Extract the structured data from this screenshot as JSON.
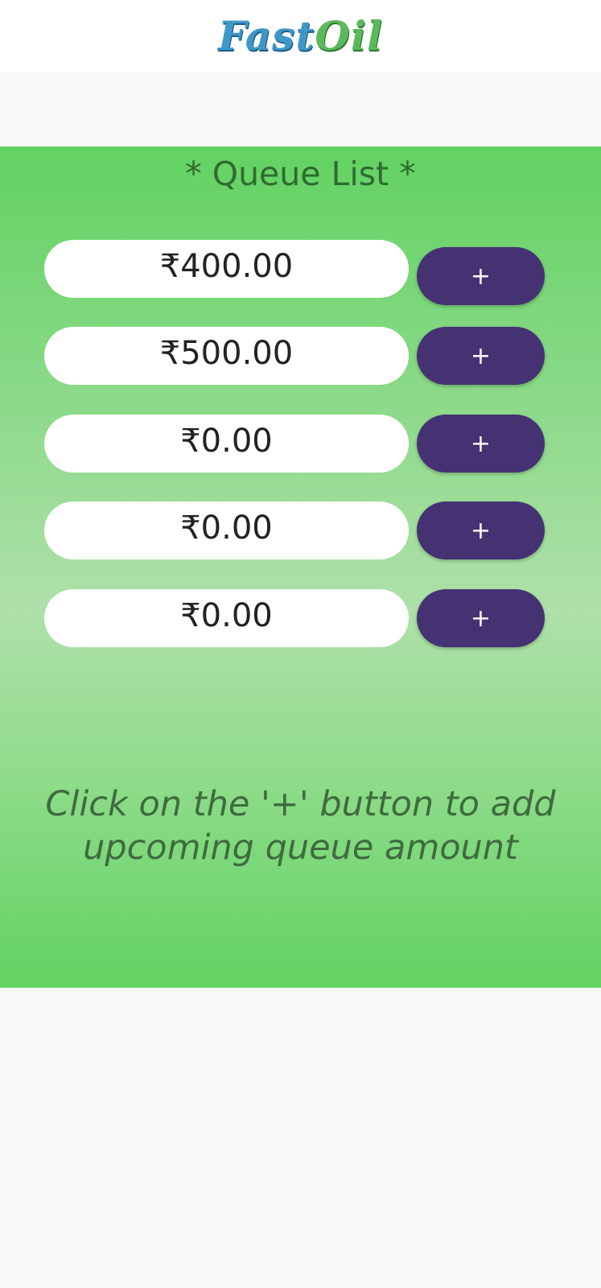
{
  "app": {
    "logo_part1": "Fast",
    "logo_part2": "Oil"
  },
  "queue": {
    "title": "* Queue List *",
    "add_label": "+",
    "items": [
      {
        "amount": "₹400.00"
      },
      {
        "amount": "₹500.00"
      },
      {
        "amount": "₹0.00"
      },
      {
        "amount": "₹0.00"
      },
      {
        "amount": "₹0.00"
      }
    ],
    "hint": "Click on the '+' button to add upcoming queue amount"
  },
  "colors": {
    "accent_button": "#453273",
    "panel_green": "#62d262",
    "logo_blue": "#3e97c7",
    "logo_green": "#5cb85c"
  }
}
